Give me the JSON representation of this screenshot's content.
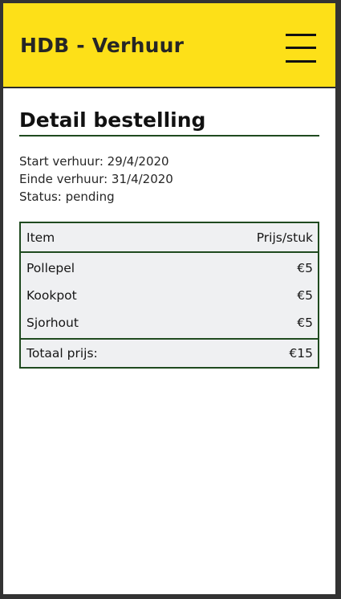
{
  "header": {
    "title": "HDB - Verhuur",
    "background_color": "#fde018",
    "menu_icon": "hamburger-menu-icon"
  },
  "page": {
    "title": "Detail bestelling"
  },
  "order": {
    "start": "Start verhuur: 29/4/2020",
    "end": "Einde verhuur: 31/4/2020",
    "status": "Status: pending"
  },
  "table": {
    "columns": [
      "Item",
      "Prijs/stuk"
    ],
    "rows": [
      {
        "item": "Pollepel",
        "price": "€5"
      },
      {
        "item": "Kookpot",
        "price": "€5"
      },
      {
        "item": "Sjorhout",
        "price": "€5"
      }
    ],
    "total_label": "Totaal prijs:",
    "total_value": "€15",
    "border_color": "#1f4a1f"
  }
}
